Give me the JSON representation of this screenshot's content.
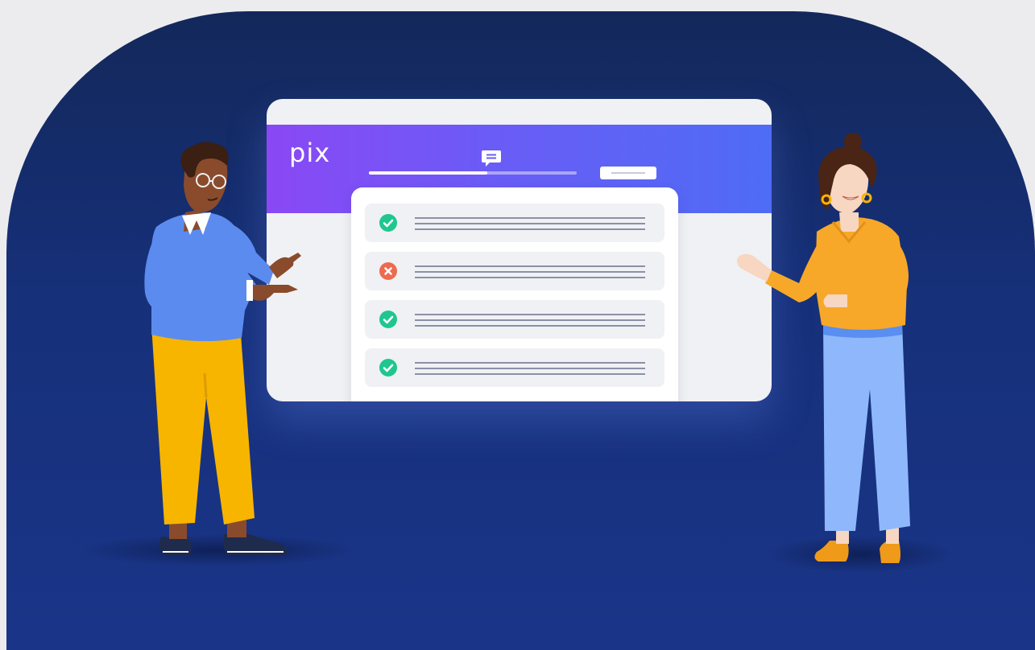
{
  "brand": {
    "logo_text": "pix",
    "header_gradient": [
      "#8a48f5",
      "#4e6cf5"
    ],
    "background": "#16307a"
  },
  "header": {
    "chat_icon": "chat-bubble-icon",
    "progress_fraction": 0.57
  },
  "answers": [
    {
      "status": "correct",
      "icon": "check-circle-icon",
      "color": "#1fc78e"
    },
    {
      "status": "incorrect",
      "icon": "x-circle-icon",
      "color": "#ee6a4f"
    },
    {
      "status": "correct",
      "icon": "check-circle-icon",
      "color": "#1fc78e"
    },
    {
      "status": "correct",
      "icon": "check-circle-icon",
      "color": "#1fc78e"
    }
  ]
}
